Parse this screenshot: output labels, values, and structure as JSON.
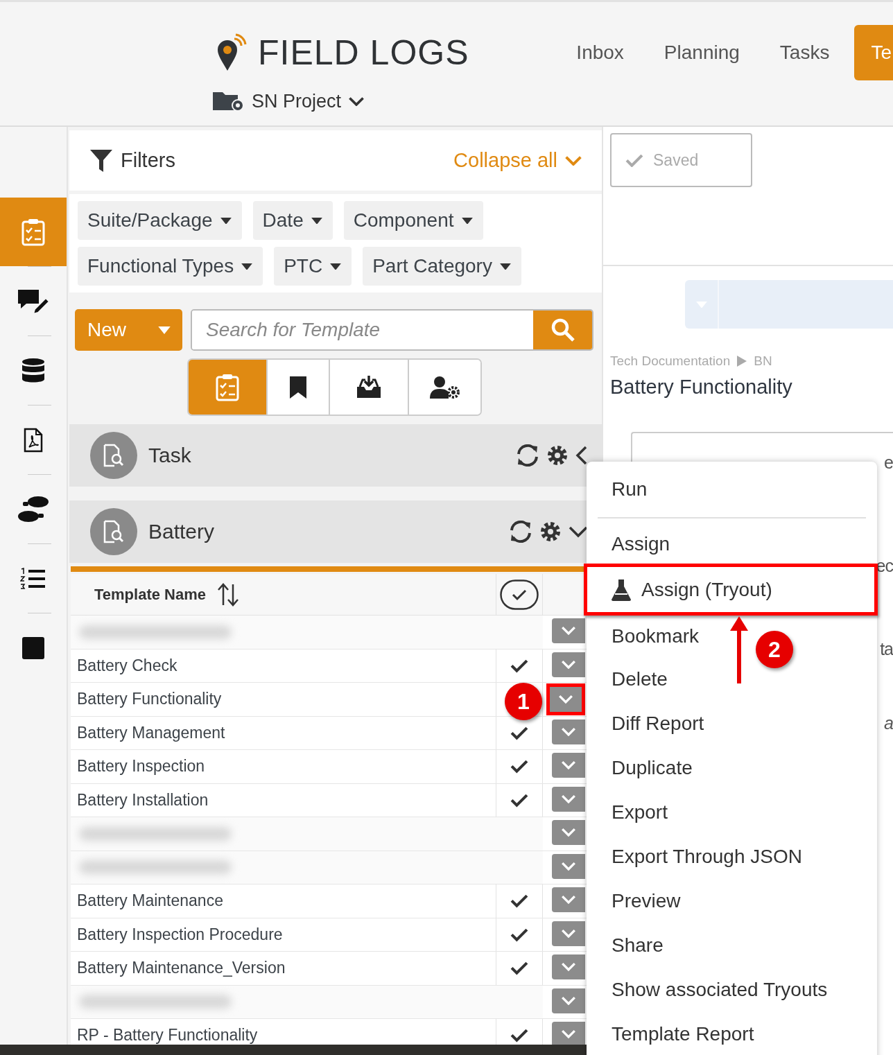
{
  "header": {
    "logo": "FIELD LOGS",
    "nav": [
      {
        "label": "Inbox",
        "selected": false
      },
      {
        "label": "Planning",
        "selected": false
      },
      {
        "label": "Tasks",
        "selected": false
      },
      {
        "label": "Te",
        "selected": true
      }
    ],
    "project": "SN Project"
  },
  "rail": [
    {
      "kind": "checklist",
      "selected": true
    },
    {
      "kind": "chat-pencil",
      "selected": false
    },
    {
      "kind": "database",
      "selected": false
    },
    {
      "kind": "pdf-file",
      "selected": false
    },
    {
      "kind": "footprints",
      "selected": false
    },
    {
      "kind": "numbered-list",
      "selected": false
    },
    {
      "kind": "square",
      "selected": false
    }
  ],
  "filters": {
    "title": "Filters",
    "collapse": "Collapse all",
    "chip_rows": [
      [
        "Suite/Package",
        "Date",
        "Component"
      ],
      [
        "Functional Types",
        "PTC",
        "Part Category"
      ]
    ]
  },
  "toolbar": {
    "new_button": "New",
    "search": {
      "placeholder": "Search for Template"
    }
  },
  "view_tabs": [
    {
      "kind": "checklist",
      "selected": true
    },
    {
      "kind": "bookmark",
      "selected": false
    },
    {
      "kind": "inbox-download",
      "selected": false
    },
    {
      "kind": "user-gear",
      "selected": false
    }
  ],
  "sections": [
    {
      "title": "Task",
      "expanded": false
    },
    {
      "title": "Battery",
      "expanded": true
    }
  ],
  "table": {
    "columns": [
      "Template Name"
    ],
    "rows": [
      {
        "kind": "blurred"
      },
      {
        "kind": "row",
        "name": "Battery Check",
        "checked": true
      },
      {
        "kind": "row",
        "name": "Battery Functionality",
        "highlighted": true
      },
      {
        "kind": "row",
        "name": "Battery Management",
        "checked": true
      },
      {
        "kind": "row",
        "name": "Battery Inspection",
        "checked": true
      },
      {
        "kind": "row",
        "name": "Battery Installation",
        "checked": true
      },
      {
        "kind": "blurred"
      },
      {
        "kind": "blurred"
      },
      {
        "kind": "row",
        "name": "Battery Maintenance",
        "checked": true
      },
      {
        "kind": "row",
        "name": "Battery Inspection Procedure",
        "checked": true
      },
      {
        "kind": "row",
        "name": "Battery Maintenance_Version",
        "checked": true
      },
      {
        "kind": "blurred"
      },
      {
        "kind": "row",
        "name": "RP - Battery Functionality",
        "checked": true
      }
    ]
  },
  "right_panel": {
    "saved": "Saved",
    "breadcrumb": [
      "Tech Documentation",
      "BN"
    ],
    "title": "Battery Functionality",
    "fragments": [
      "e",
      "ec",
      "ta",
      "a"
    ]
  },
  "menu": {
    "items": [
      {
        "kind": "item",
        "label": "Run",
        "highlighted": false
      },
      {
        "kind": "divider"
      },
      {
        "kind": "item",
        "label": "Assign",
        "highlighted": false
      },
      {
        "kind": "flask-item",
        "label": "Assign (Tryout)",
        "highlighted": true
      },
      {
        "kind": "item",
        "label": "Bookmark",
        "highlighted": false
      },
      {
        "kind": "item",
        "label": "Delete",
        "highlighted": false
      },
      {
        "kind": "item",
        "label": "Diff Report",
        "highlighted": false
      },
      {
        "kind": "item",
        "label": "Duplicate",
        "highlighted": false
      },
      {
        "kind": "item",
        "label": "Export",
        "highlighted": false
      },
      {
        "kind": "item",
        "label": "Export Through JSON",
        "highlighted": false
      },
      {
        "kind": "item",
        "label": "Preview",
        "highlighted": false
      },
      {
        "kind": "item",
        "label": "Share",
        "highlighted": false
      },
      {
        "kind": "item",
        "label": "Show associated Tryouts",
        "highlighted": false
      },
      {
        "kind": "item",
        "label": "Template Report",
        "highlighted": false
      }
    ]
  },
  "annotations": [
    {
      "label": "1"
    },
    {
      "label": "2"
    }
  ]
}
